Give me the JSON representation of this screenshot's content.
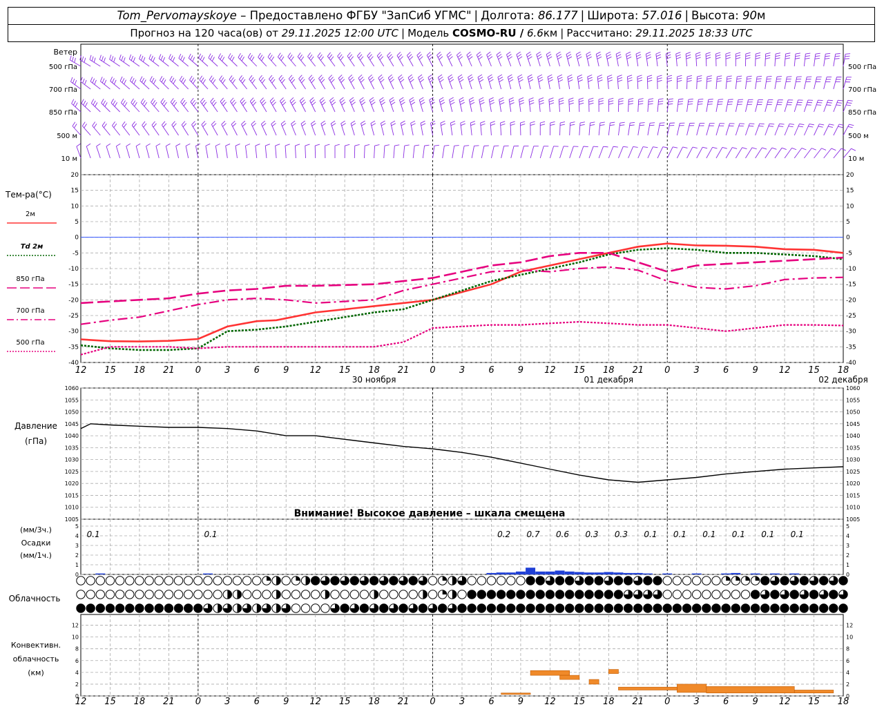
{
  "header": {
    "station": "Tom_Pervomayskoye",
    "provider": "– Предоставлено ФГБУ \"ЗапСиб УГМС\"",
    "lon_label": "Долгота:",
    "lon": "86.177",
    "lat_label": "Широта:",
    "lat": "57.016",
    "alt_label": "Высота:",
    "alt": "90",
    "alt_unit": "м",
    "forecast_label": "Прогноз на 120 часа(ов) от",
    "forecast_start": "29.11.2025 12:00 UTC",
    "model_label": "Модель",
    "model": "COSMO-RU /",
    "resolution": "6.6",
    "resolution_unit": "км",
    "calc_label": "Рассчитано:",
    "calc_time": "29.11.2025 18:33 UTC"
  },
  "x_axis": {
    "hour_labels": [
      "12",
      "15",
      "18",
      "21",
      "0",
      "3",
      "6",
      "9",
      "12",
      "15",
      "18",
      "21",
      "0",
      "3",
      "6",
      "9",
      "12",
      "15",
      "18",
      "21",
      "0",
      "3",
      "6",
      "9",
      "12",
      "15",
      "18"
    ],
    "date_labels": [
      {
        "hour": 30,
        "text": "30 ноября"
      },
      {
        "hour": 54,
        "text": "01 декабря"
      },
      {
        "hour": 78,
        "text": "02 декабря"
      }
    ],
    "midnight_hours": [
      12,
      36,
      60
    ]
  },
  "wind_panel": {
    "title": "Ветер",
    "levels": [
      "500 гПа",
      "700 гПа",
      "850 гПа",
      "500 м",
      "10 м"
    ]
  },
  "temp_panel": {
    "title": "Тем-ра(°С)",
    "legend": [
      {
        "label": "2м",
        "color": "#ff3333",
        "style": "solid"
      },
      {
        "label": "Td  2м",
        "color": "#006600",
        "style": "dotted"
      },
      {
        "label": "850 гПа",
        "color": "#e6007e",
        "style": "longdash"
      },
      {
        "label": "700 гПа",
        "color": "#e6007e",
        "style": "dashdot"
      },
      {
        "label": "500 гПа",
        "color": "#e6007e",
        "style": "dotted"
      }
    ],
    "yticks": [
      "20",
      "15",
      "10",
      "5",
      "0",
      "-5",
      "-10",
      "-15",
      "-20",
      "-25",
      "-30",
      "-35",
      "-40"
    ]
  },
  "pressure_panel": {
    "title": "Давление",
    "unit": "(гПа)",
    "yticks": [
      "1060",
      "1055",
      "1050",
      "1045",
      "1040",
      "1035",
      "1030",
      "1025",
      "1020",
      "1015",
      "1010",
      "1005"
    ],
    "warning": "Внимание! Высокое давление – шкала смещена"
  },
  "precip_panel": {
    "title1": "(мм/3ч.)",
    "title2": "Осадки",
    "title3": "(мм/1ч.)",
    "yticks": [
      "5",
      "4",
      "3",
      "2",
      "1",
      "0"
    ],
    "labels": [
      {
        "hour": 1,
        "text": "0.1"
      },
      {
        "hour": 13,
        "text": "0.1"
      },
      {
        "hour": 43,
        "text": "0.2"
      },
      {
        "hour": 46,
        "text": "0.7"
      },
      {
        "hour": 49,
        "text": "0.6"
      },
      {
        "hour": 52,
        "text": "0.3"
      },
      {
        "hour": 55,
        "text": "0.3"
      },
      {
        "hour": 58,
        "text": "0.1"
      },
      {
        "hour": 61,
        "text": "0.1"
      },
      {
        "hour": 64,
        "text": "0.1"
      },
      {
        "hour": 67,
        "text": "0.1"
      },
      {
        "hour": 70,
        "text": "0.1"
      },
      {
        "hour": 73,
        "text": "0.1"
      }
    ]
  },
  "cloud_panel": {
    "title": "Облачность"
  },
  "conv_panel": {
    "title1": "Конвективн.",
    "title2": "облачность",
    "title3": "(км)",
    "yticks": [
      "12",
      "10",
      "8",
      "6",
      "4",
      "2",
      "0"
    ]
  },
  "colors": {
    "wind": "#8a2be2",
    "precip": "#1f3fd6",
    "conv": "#f08a2a",
    "zero_line": "#3355ff"
  },
  "chart_data": [
    {
      "type": "line",
      "title": "Тем-ра(°С)",
      "x_unit": "hours since 29.11.2025 12:00 UTC",
      "ylim": [
        -40,
        20
      ],
      "series": [
        {
          "name": "2м",
          "x": [
            0,
            3,
            6,
            9,
            12,
            15,
            18,
            20,
            24,
            30,
            33,
            36,
            42,
            45,
            48,
            51,
            54,
            57,
            60,
            63,
            66,
            69,
            72,
            75,
            78
          ],
          "values": [
            -32.6,
            -33.2,
            -33.3,
            -33.1,
            -32.5,
            -28.5,
            -26.8,
            -26.5,
            -24,
            -22,
            -21,
            -20,
            -15,
            -11,
            -9,
            -7,
            -5,
            -3,
            -2,
            -2.6,
            -2.7,
            -3,
            -3.8,
            -4,
            -5
          ]
        },
        {
          "name": "Td  2м",
          "x": [
            0,
            3,
            6,
            9,
            12,
            15,
            18,
            21,
            24,
            30,
            33,
            36,
            42,
            45,
            48,
            51,
            54,
            57,
            60,
            63,
            66,
            69,
            72,
            75,
            78
          ],
          "values": [
            -34.5,
            -35.5,
            -36,
            -36,
            -35.5,
            -30,
            -29.5,
            -28.5,
            -27,
            -24,
            -23,
            -20,
            -14,
            -12,
            -10,
            -8,
            -5.5,
            -4,
            -3.5,
            -4,
            -5,
            -5,
            -5.5,
            -6,
            -7
          ]
        },
        {
          "name": "850 гПа",
          "x": [
            0,
            3,
            6,
            9,
            12,
            15,
            18,
            21,
            24,
            30,
            33,
            36,
            42,
            45,
            48,
            51,
            54,
            57,
            60,
            63,
            66,
            69,
            72,
            75,
            78
          ],
          "values": [
            -21,
            -20.5,
            -20,
            -19.5,
            -18,
            -17,
            -16.5,
            -15.5,
            -15.5,
            -15,
            -14,
            -13,
            -9,
            -8,
            -6,
            -5,
            -5,
            -8,
            -11,
            -9,
            -8.5,
            -8,
            -7.5,
            -7,
            -6.5
          ]
        },
        {
          "name": "700 гПа",
          "x": [
            0,
            3,
            6,
            9,
            12,
            15,
            18,
            21,
            24,
            30,
            33,
            36,
            42,
            45,
            48,
            51,
            54,
            57,
            60,
            63,
            66,
            69,
            72,
            75,
            78
          ],
          "values": [
            -27.8,
            -26.5,
            -25.5,
            -23.5,
            -21.5,
            -20,
            -19.5,
            -20,
            -21,
            -20,
            -17,
            -15,
            -11,
            -10.5,
            -11,
            -10,
            -9.5,
            -10.5,
            -14,
            -16,
            -16.5,
            -15.5,
            -13.5,
            -13,
            -12.8
          ]
        },
        {
          "name": "500 гПа",
          "x": [
            0,
            3,
            6,
            9,
            12,
            15,
            18,
            21,
            24,
            30,
            33,
            36,
            42,
            45,
            48,
            51,
            54,
            57,
            60,
            63,
            66,
            69,
            72,
            75,
            78
          ],
          "values": [
            -37.5,
            -35,
            -35,
            -35,
            -35.5,
            -35,
            -35,
            -35,
            -35,
            -35,
            -33.5,
            -29,
            -28,
            -28,
            -27.5,
            -27,
            -27.5,
            -28,
            -28,
            -29,
            -30,
            -29,
            -28,
            -28,
            -28.2
          ]
        }
      ]
    },
    {
      "type": "line",
      "title": "Давление",
      "ylabel": "(гПа)",
      "ylim": [
        1005,
        1060
      ],
      "series": [
        {
          "name": "Давление",
          "x": [
            0,
            1,
            3,
            6,
            9,
            12,
            15,
            18,
            21,
            24,
            30,
            33,
            36,
            39,
            42,
            45,
            48,
            51,
            54,
            57,
            60,
            63,
            66,
            69,
            72,
            75,
            78
          ],
          "values": [
            1043,
            1045,
            1044.5,
            1044,
            1043.5,
            1043.5,
            1043,
            1042,
            1040,
            1040,
            1037,
            1035.5,
            1034.5,
            1033,
            1031,
            1028.5,
            1026,
            1023.5,
            1021.5,
            1020.5,
            1021.5,
            1022.5,
            1024,
            1025,
            1026,
            1026.5,
            1027
          ]
        }
      ]
    },
    {
      "type": "bar",
      "title": "Осадки",
      "ylabel": "(мм/1ч.)",
      "ylim": [
        0,
        5
      ],
      "x": [
        2,
        13,
        42,
        43,
        44,
        45,
        46,
        47,
        48,
        49,
        50,
        51,
        52,
        53,
        54,
        55,
        56,
        57,
        58,
        60,
        63,
        66,
        67,
        69,
        71,
        73
      ],
      "values": [
        0.1,
        0.1,
        0.15,
        0.2,
        0.2,
        0.3,
        0.7,
        0.3,
        0.3,
        0.4,
        0.3,
        0.25,
        0.2,
        0.2,
        0.25,
        0.2,
        0.15,
        0.15,
        0.1,
        0.1,
        0.1,
        0.1,
        0.15,
        0.1,
        0.1,
        0.1
      ]
    },
    {
      "type": "bar",
      "title": "Конвективн. облачность (км)",
      "ylim": [
        0,
        13
      ],
      "segments": [
        {
          "x0": 43,
          "x1": 46,
          "bottom": 0.3,
          "top": 0.5
        },
        {
          "x0": 46,
          "x1": 50,
          "bottom": 3.5,
          "top": 4.3
        },
        {
          "x0": 49,
          "x1": 51,
          "bottom": 2.8,
          "top": 3.5
        },
        {
          "x0": 52,
          "x1": 53,
          "bottom": 2.0,
          "top": 2.8
        },
        {
          "x0": 54,
          "x1": 55,
          "bottom": 3.8,
          "top": 4.5
        },
        {
          "x0": 55,
          "x1": 61,
          "bottom": 1.0,
          "top": 1.5
        },
        {
          "x0": 61,
          "x1": 64,
          "bottom": 0.6,
          "top": 2.0
        },
        {
          "x0": 64,
          "x1": 73,
          "bottom": 0.5,
          "top": 1.6
        },
        {
          "x0": 73,
          "x1": 77,
          "bottom": 0.5,
          "top": 1.0
        }
      ]
    }
  ]
}
